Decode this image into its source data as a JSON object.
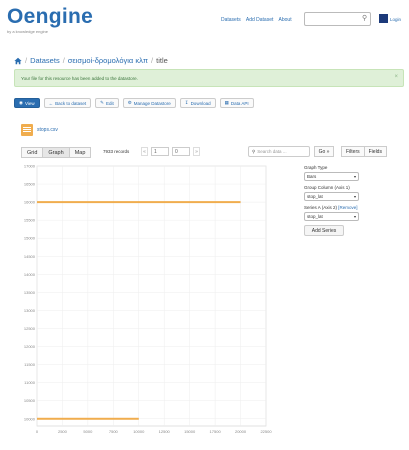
{
  "header": {
    "logo_text": "Oengine",
    "logo_sub": "by a knowledge engine",
    "nav": [
      "Datasets",
      "Add Dataset",
      "About"
    ],
    "search_placeholder": "",
    "user_label": "Login"
  },
  "breadcrumb": {
    "items": [
      "Datasets",
      "σεισμοί-δρομολόγια κλπ",
      "title"
    ]
  },
  "flash": {
    "message": "Your file for this resource has been added to the datastore."
  },
  "toolbar": {
    "buttons": [
      "View",
      "Back to dataset",
      "Edit",
      "Manage Datastore",
      "Download",
      "Data API"
    ]
  },
  "resource": {
    "name": "stops.csv"
  },
  "viewtabs": [
    "Grid",
    "Graph",
    "Map"
  ],
  "records": {
    "label": "7933 records",
    "from": "1",
    "to": "0"
  },
  "data_search": {
    "placeholder": "Search data ...",
    "go": "Go »"
  },
  "filter_buttons": [
    "Filters",
    "Fields"
  ],
  "chart_data": {
    "type": "bar",
    "orientation": "horizontal",
    "x_ticks": [
      0,
      2500,
      5000,
      7500,
      10000,
      12500,
      15000,
      17500,
      20000,
      22500
    ],
    "y_ticks": [
      10000,
      10500,
      11000,
      11500,
      12000,
      12500,
      13000,
      13500,
      14000,
      14500,
      15000,
      15500,
      16000,
      16500,
      17000
    ],
    "xlim": [
      0,
      22500
    ],
    "ylim": [
      9800,
      17000
    ],
    "grid": true,
    "color": "#f0ad4e",
    "bars": [
      {
        "y": 16000,
        "x": 20000
      },
      {
        "y": 10000,
        "x": 10000
      }
    ]
  },
  "editor": {
    "graph_type_label": "Graph Type",
    "graph_type_value": "Bars",
    "group_column_label": "Group Column (Axis 1)",
    "group_column_value": "stop_lat",
    "series_label": "Series A (Axis 2)",
    "remove_label": "[Remove]",
    "series_value": "stop_lat",
    "add_series": "Add Series"
  }
}
